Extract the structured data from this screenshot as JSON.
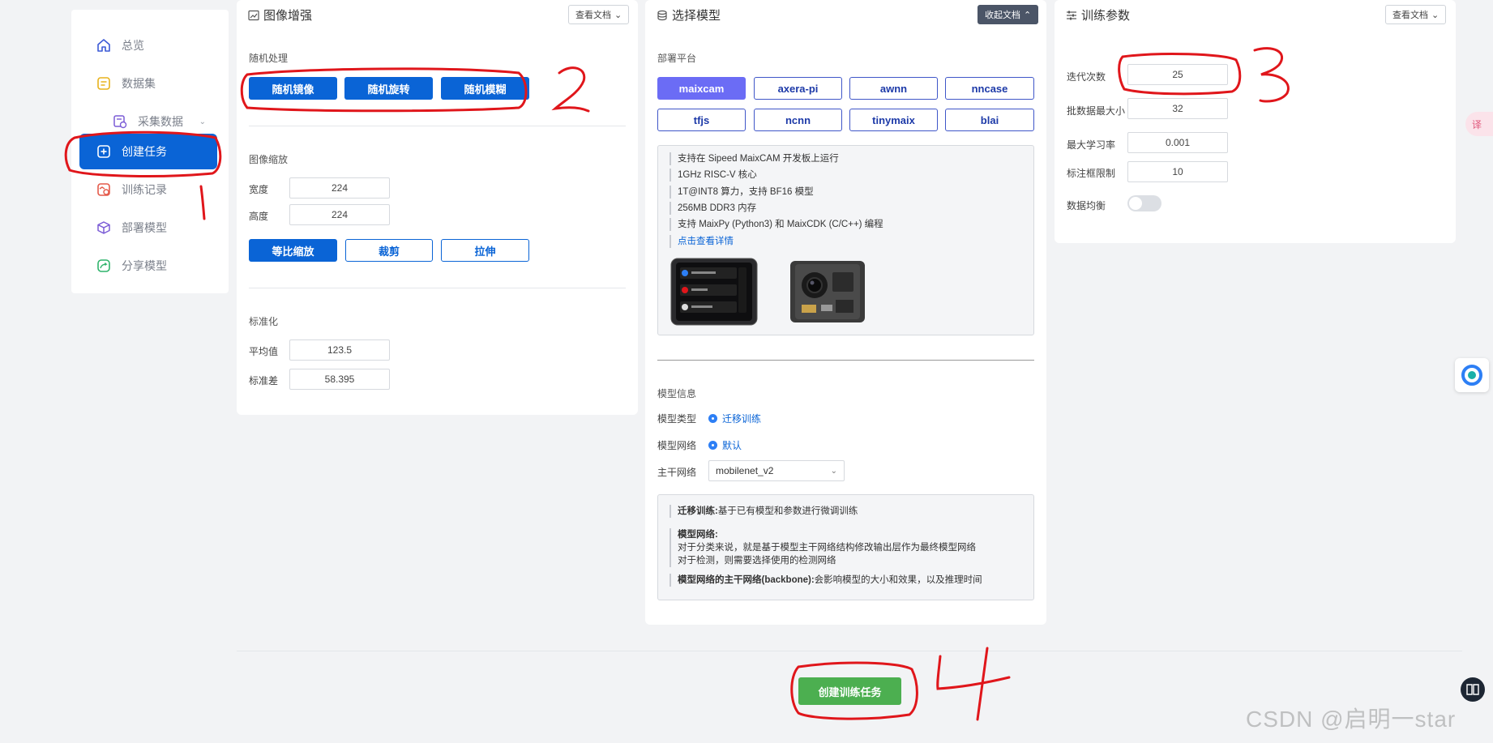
{
  "sidebar": {
    "items": [
      {
        "label": "总览",
        "icon": "home-icon"
      },
      {
        "label": "数据集",
        "icon": "dataset-icon"
      },
      {
        "label": "采集数据",
        "icon": "collect-icon"
      },
      {
        "label": "创建任务",
        "icon": "plus-square-icon",
        "active": true
      },
      {
        "label": "训练记录",
        "icon": "train-record-icon"
      },
      {
        "label": "部署模型",
        "icon": "cube-icon"
      },
      {
        "label": "分享模型",
        "icon": "share-icon"
      }
    ]
  },
  "augment": {
    "title": "图像增强",
    "doc_btn": "查看文档",
    "random_label": "随机处理",
    "random_buttons": [
      "随机镜像",
      "随机旋转",
      "随机模糊"
    ],
    "scale_label": "图像缩放",
    "width_label": "宽度",
    "width_value": "224",
    "height_label": "高度",
    "height_value": "224",
    "scale_buttons": [
      "等比缩放",
      "裁剪",
      "拉伸"
    ],
    "norm_label": "标准化",
    "mean_label": "平均值",
    "mean_value": "123.5",
    "std_label": "标准差",
    "std_value": "58.395"
  },
  "model": {
    "title": "选择模型",
    "collapse_btn": "收起文档",
    "platform_label": "部署平台",
    "platforms": [
      "maixcam",
      "axera-pi",
      "awnn",
      "nncase",
      "tfjs",
      "ncnn",
      "tinymaix",
      "blai"
    ],
    "platform_info": [
      "支持在 Sipeed MaixCAM 开发板上运行",
      "1GHz RISC-V 核心",
      "1T@INT8 算力，支持 BF16 模型",
      "256MB DDR3 内存",
      "支持 MaixPy (Python3) 和 MaixCDK (C/C++) 编程"
    ],
    "platform_link": "点击查看详情",
    "info_label": "模型信息",
    "type_label": "模型类型",
    "type_value": "迁移训练",
    "net_label": "模型网络",
    "net_value": "默认",
    "backbone_label": "主干网络",
    "backbone_value": "mobilenet_v2",
    "desc": {
      "transfer_title": "迁移训练:",
      "transfer_text": "基于已有模型和参数进行微调训练",
      "net_title": "模型网络:",
      "net_line1": "对于分类来说，就是基于模型主干网络结构修改输出层作为最终模型网络",
      "net_line2": "对于检测，则需要选择使用的检测网络",
      "backbone_title": "模型网络的主干网络(backbone):",
      "backbone_text": "会影响模型的大小和效果，以及推理时间"
    }
  },
  "train": {
    "title": "训练参数",
    "doc_btn": "查看文档",
    "epochs_label": "迭代次数",
    "epochs_value": "25",
    "batch_label": "批数据最大小",
    "batch_value": "32",
    "lr_label": "最大学习率",
    "lr_value": "0.001",
    "box_label": "标注框限制",
    "box_value": "10",
    "balance_label": "数据均衡",
    "balance_on": false
  },
  "create_button": "创建训练任务",
  "annotations": [
    "1",
    "2",
    "3",
    "4"
  ],
  "watermark": "CSDN @启明一star",
  "colors": {
    "primary": "#0a64d6",
    "purple": "#6b6cf5",
    "green": "#4caf50",
    "annotation_red": "#e0161b"
  }
}
